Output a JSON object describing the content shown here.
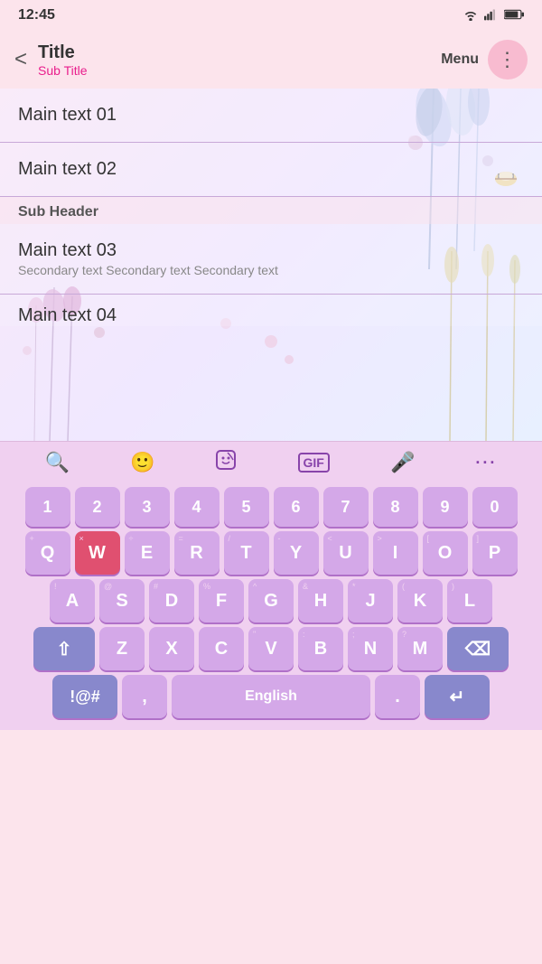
{
  "statusBar": {
    "time": "12:45",
    "wifi": "wifi",
    "signal": "signal",
    "battery": "battery"
  },
  "header": {
    "backLabel": "<",
    "title": "Title",
    "subtitle": "Sub Title",
    "menuLabel": "Menu",
    "menuDots": "⋮"
  },
  "listItems": [
    {
      "id": 1,
      "main": "Main text 01",
      "secondary": ""
    },
    {
      "id": 2,
      "main": "Main text 02",
      "secondary": ""
    },
    {
      "id": 3,
      "main": "Main text 03",
      "secondary": "Secondary text Secondary text Secondary text"
    },
    {
      "id": 4,
      "main": "Main text 04",
      "secondary": ""
    }
  ],
  "subHeader": "Sub Header",
  "toolbar": {
    "searchIcon": "🔍",
    "emojiIcon": "🙂",
    "stickerIcon": "🎭",
    "gifLabel": "GIF",
    "micIcon": "🎤",
    "moreIcon": "..."
  },
  "keyboard": {
    "row0": [
      "1",
      "2",
      "3",
      "4",
      "5",
      "6",
      "7",
      "8",
      "9",
      "0"
    ],
    "row1": [
      "Q",
      "W",
      "E",
      "R",
      "T",
      "Y",
      "U",
      "I",
      "O",
      "P"
    ],
    "row2": [
      "A",
      "S",
      "D",
      "F",
      "G",
      "H",
      "J",
      "K",
      "L"
    ],
    "row3": [
      "Z",
      "X",
      "C",
      "V",
      "B",
      "N",
      "M"
    ],
    "superscripts": {
      "Q": "+",
      "W": "×",
      "E": "÷",
      "R": "=",
      "T": "/",
      "Y": "-",
      "U": "<",
      "I": ">",
      "O": "[",
      "P": "]",
      "A": "!",
      "S": "@",
      "D": "#",
      "F": "%",
      "G": "^",
      "H": "&",
      "J": "*",
      "K": "(",
      "L": ")",
      "Z": "",
      "X": "",
      "C": "",
      "V": "\"",
      "B": ":",
      "N": ";",
      "M": "?"
    },
    "spaceLabel": "English",
    "specialLeft": "!@#",
    "comma": ",",
    "period": ".",
    "enterIcon": "↵",
    "shiftIcon": "⇧",
    "backspaceIcon": "⌫"
  },
  "colors": {
    "pinkAccent": "#e91e8c",
    "keyNormal": "#d4a8e8",
    "keySpecial": "#8888cc",
    "keyActive": "#e05070"
  }
}
